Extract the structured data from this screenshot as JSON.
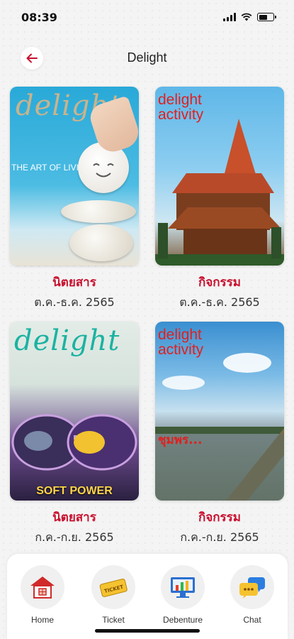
{
  "status_bar": {
    "time": "08:39"
  },
  "header": {
    "title": "Delight"
  },
  "items": [
    {
      "category": "นิตยสาร",
      "period": "ต.ค.-ธ.ค. 2565",
      "cover": {
        "logo": "delight",
        "headline": "THE ART OF LIVING"
      }
    },
    {
      "category": "กิจกรรม",
      "period": "ต.ค.-ธ.ค. 2565",
      "cover": {
        "logo": "delight activity"
      }
    },
    {
      "category": "นิตยสาร",
      "period": "ก.ค.-ก.ย. 2565",
      "cover": {
        "logo": "delight",
        "headline": "SOFT POWER"
      }
    },
    {
      "category": "กิจกรรม",
      "period": "ก.ค.-ก.ย. 2565",
      "cover": {
        "logo": "delight activity",
        "headline": "ชุมพร..."
      }
    }
  ],
  "bottom_nav": [
    {
      "label": "Home",
      "icon": "home-icon"
    },
    {
      "label": "Ticket",
      "icon": "ticket-icon"
    },
    {
      "label": "Debenture",
      "icon": "chart-monitor-icon"
    },
    {
      "label": "Chat",
      "icon": "chat-icon"
    }
  ],
  "colors": {
    "accent": "#c8102e",
    "background": "#f4f4f4"
  }
}
